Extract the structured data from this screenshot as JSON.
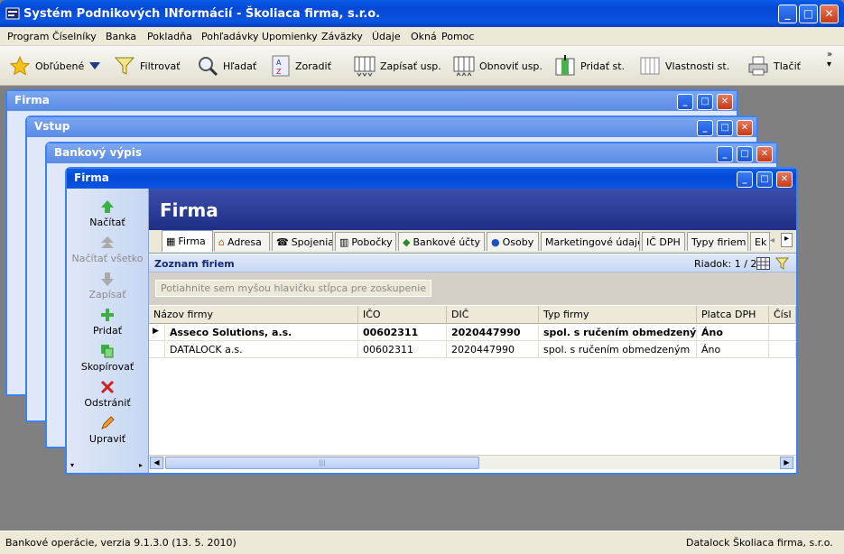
{
  "app": {
    "title": "Systém Podnikových INformácií - Školiaca firma, s.r.o."
  },
  "menu": [
    "Program",
    "Číselníky",
    "Banka",
    "Pokladňa",
    "Pohľadávky",
    "Upomienky",
    "Záväzky",
    "Údaje",
    "Okná",
    "Pomoc"
  ],
  "toolbar": {
    "favorites": "Obľúbené",
    "filter": "Filtrovať",
    "find": "Hľadať",
    "sort": "Zoradiť",
    "write_set": "Zapísať usp.",
    "restore_set": "Obnoviť usp.",
    "add_col": "Pridať st.",
    "col_props": "Vlastnosti st.",
    "print": "Tlačiť"
  },
  "windows": {
    "w1": "Firma",
    "w2": "Vstup",
    "w3": "Bankový výpis",
    "w4": "Firma"
  },
  "left_panel": {
    "load": "Načítať",
    "load_all": "Načítať všetko",
    "write": "Zapísať",
    "add": "Pridať",
    "copy": "Skopírovať",
    "delete": "Odstrániť",
    "edit": "Upraviť"
  },
  "main": {
    "title": "Firma",
    "tabs": [
      "Firma",
      "Adresa",
      "Spojenia",
      "Pobočky",
      "Bankové účty",
      "Osoby",
      "Marketingové údaje",
      "IČ DPH",
      "Typy firiem",
      "Ek"
    ],
    "list_title": "Zoznam firiem",
    "row_counter": "Riadok: 1 / 2",
    "group_hint": "Potiahnite sem myšou hlavičku stĺpca pre zoskupenie",
    "columns": [
      "Názov firmy",
      "IČO",
      "DIČ",
      "Typ firmy",
      "Platca DPH",
      "Čísl"
    ],
    "rows": [
      [
        "Asseco Solutions, a.s.",
        "00602311",
        "2020447990",
        "spol. s ručením obmedzeným",
        "Áno",
        ""
      ],
      [
        "DATALOCK a.s.",
        "00602311",
        "2020447990",
        "spol. s ručením obmedzeným",
        "Áno",
        ""
      ]
    ]
  },
  "status": {
    "left": "Bankové operácie, verzia 9.1.3.0 (13. 5. 2010)",
    "user": "Datalock",
    "company": "Školiaca firma, s.r.o."
  }
}
